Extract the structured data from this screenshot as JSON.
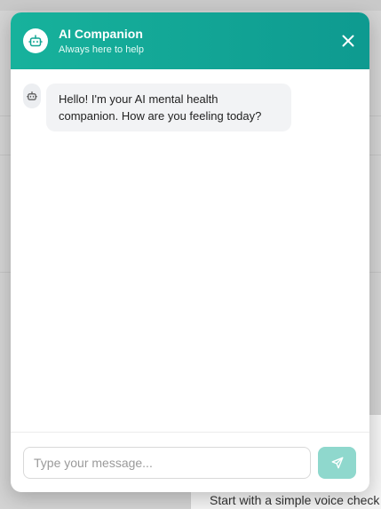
{
  "header": {
    "title": "AI Companion",
    "subtitle": "Always here to help",
    "avatar_icon": "robot-icon",
    "close_icon": "close-icon"
  },
  "messages": [
    {
      "sender": "bot",
      "avatar_icon": "robot-icon",
      "text": "Hello! I'm your AI mental health companion. How are you feeling today?"
    }
  ],
  "composer": {
    "placeholder": "Type your message...",
    "value": "",
    "send_icon": "send-icon"
  },
  "background": {
    "card_text": "Start with a simple voice check"
  },
  "colors": {
    "header_start": "#17b29c",
    "header_end": "#0e9a90",
    "send_button": "#8fd8cd",
    "bubble": "#f2f3f5"
  }
}
